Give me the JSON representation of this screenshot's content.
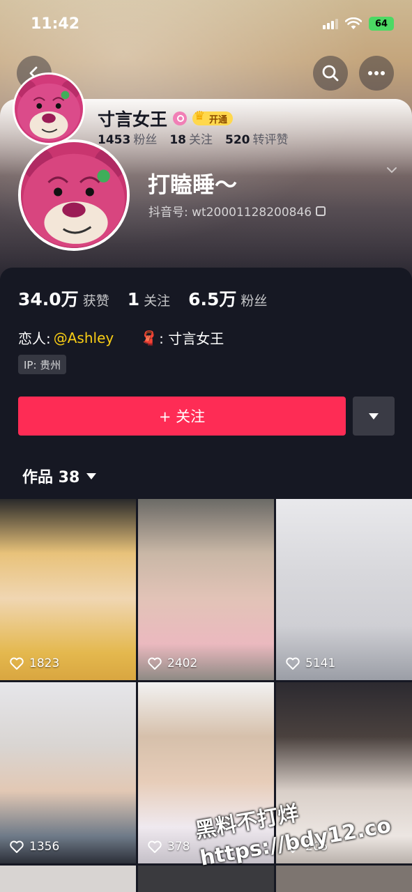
{
  "status_bar": {
    "time": "11:42",
    "battery": "64"
  },
  "compact": {
    "name": "寸言女王",
    "badge": "开通",
    "followers_value": "1453",
    "followers_label": "粉丝",
    "following_value": "18",
    "following_label": "关注",
    "reposts_value": "520",
    "reposts_label": "转评赞"
  },
  "profile": {
    "nickname": "打瞌睡～",
    "douyin_id": "抖音号: wt20001128200846",
    "stats": [
      {
        "value": "34.0万",
        "label": "获赞"
      },
      {
        "value": "1",
        "label": "关注"
      },
      {
        "value": "6.5万",
        "label": "粉丝"
      }
    ],
    "bio_prefix": "恋人:",
    "bio_mention": "@Ashley",
    "bio_partner": ": 寸言女王",
    "ip": "IP: 贵州",
    "follow_label": "+ 关注",
    "works_label": "作品 38"
  },
  "videos": [
    {
      "likes": "1823"
    },
    {
      "likes": "2402"
    },
    {
      "likes": "5141"
    },
    {
      "likes": "1356"
    },
    {
      "likes": "378"
    },
    {
      "likes": "205"
    }
  ],
  "watermark": {
    "line1": "黑料不打烊",
    "line2": "https://bdy12.co"
  }
}
